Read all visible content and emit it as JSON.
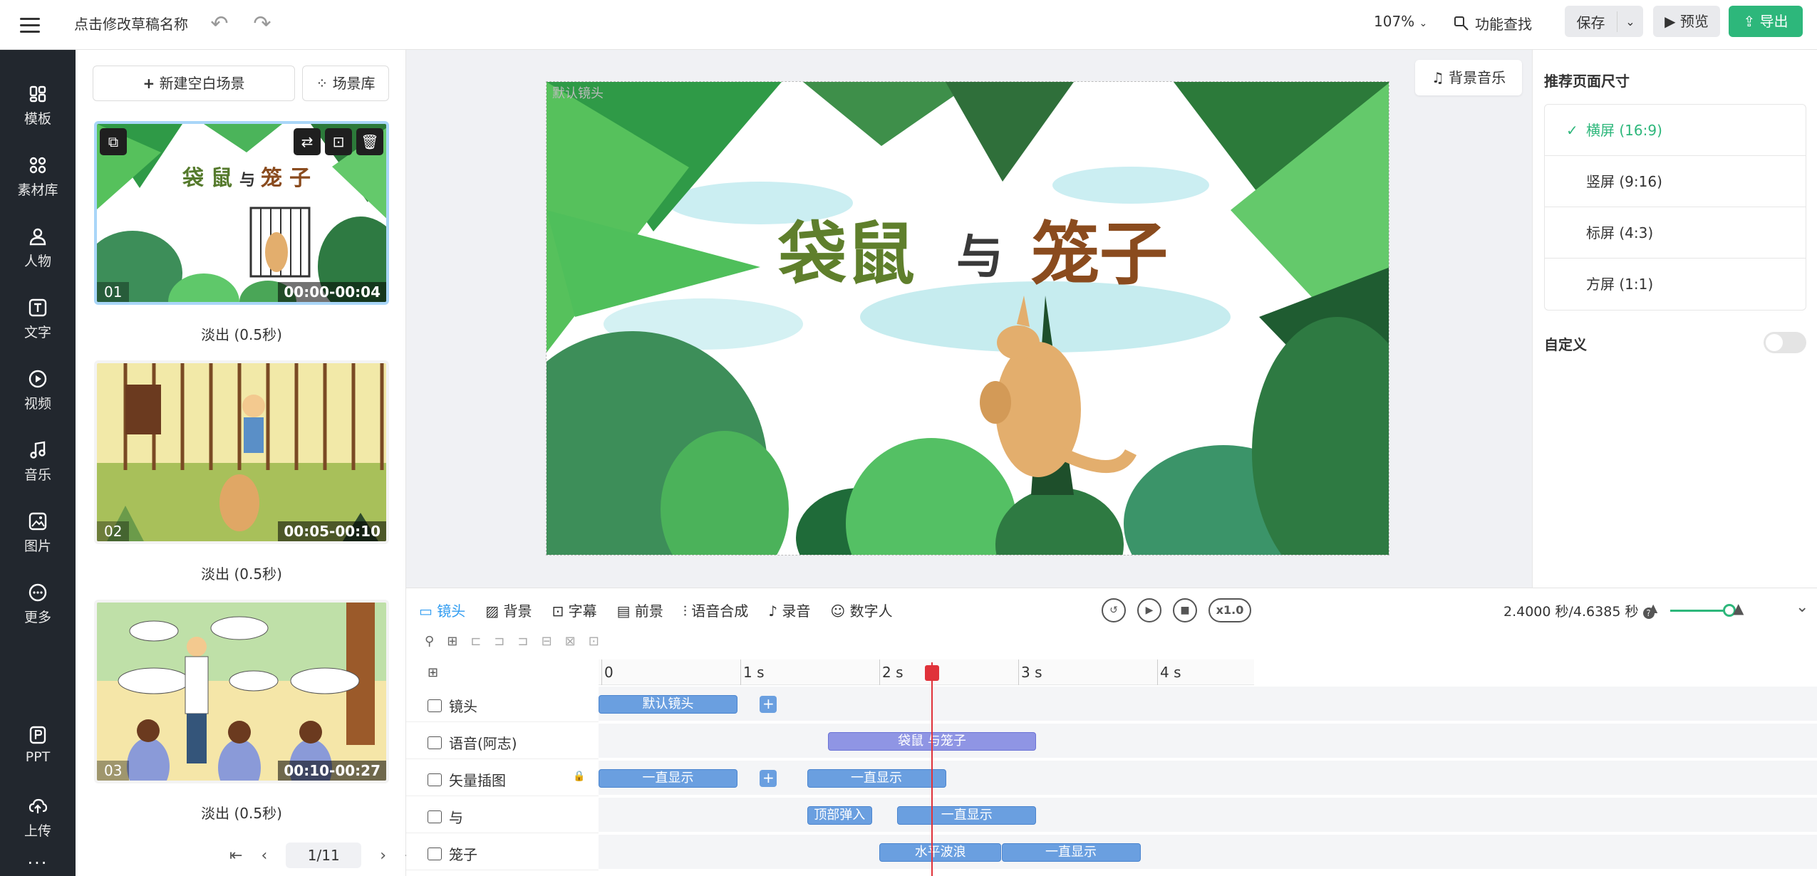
{
  "topbar": {
    "title": "点击修改草稿名称",
    "zoom": "107%",
    "find_label": "功能查找",
    "save_label": "保存",
    "preview_label": "预览",
    "export_label": "导出"
  },
  "nav": [
    {
      "label": "模板",
      "icon": "template-icon"
    },
    {
      "label": "素材库",
      "icon": "materials-icon"
    },
    {
      "label": "人物",
      "icon": "person-icon"
    },
    {
      "label": "文字",
      "icon": "text-icon"
    },
    {
      "label": "视频",
      "icon": "video-icon"
    },
    {
      "label": "音乐",
      "icon": "music-icon"
    },
    {
      "label": "图片",
      "icon": "image-icon"
    },
    {
      "label": "更多",
      "icon": "more-icon"
    },
    {
      "label": "PPT",
      "icon": "ppt-icon"
    },
    {
      "label": "上传",
      "icon": "upload-icon"
    }
  ],
  "scenes": {
    "new_label": "新建空白场景",
    "library_label": "场景库",
    "items": [
      {
        "num": "01",
        "time": "00:00-00:04",
        "transition": "淡出 (0.5秒)"
      },
      {
        "num": "02",
        "time": "00:05-00:10",
        "transition": "淡出 (0.5秒)"
      },
      {
        "num": "03",
        "time": "00:10-00:27",
        "transition": "淡出 (0.5秒)"
      }
    ],
    "page": "1/11"
  },
  "canvas": {
    "bgm_label": "背景音乐",
    "title_a": "袋鼠",
    "title_b": "与",
    "title_c": "笼子",
    "lens_label": "默认镜头"
  },
  "right_panel": {
    "title": "推荐页面尺寸",
    "options": [
      "横屏 (16:9)",
      "竖屏 (9:16)",
      "标屏 (4:3)",
      "方屏 (1:1)"
    ],
    "selected_index": 0,
    "custom_label": "自定义",
    "custom_on": false
  },
  "timeline": {
    "tabs": [
      "镜头",
      "背景",
      "字幕",
      "前景",
      "语音合成",
      "录音",
      "数字人"
    ],
    "speed": "x1.0",
    "time": "2.4000 秒/4.6385 秒",
    "zoom_level": 0.9,
    "playhead_seconds": 2.4,
    "ruler": [
      "0",
      "1 s",
      "2 s",
      "3 s",
      "4 s"
    ],
    "tracks": [
      {
        "label": "镜头",
        "clips": [
          {
            "text": "默认镜头",
            "start": 0,
            "end": 1.0,
            "type": "blue"
          }
        ]
      },
      {
        "label": "语音(阿志)",
        "clips": [
          {
            "text": "袋鼠 与笼子",
            "start": 1.65,
            "end": 3.15,
            "type": "purple"
          }
        ]
      },
      {
        "label": "矢量插图",
        "clips": [
          {
            "text": "一直显示",
            "start": 0,
            "end": 1.0,
            "type": "blue"
          },
          {
            "text": "一直显示",
            "start": 1.5,
            "end": 2.5,
            "type": "blue"
          }
        ]
      },
      {
        "label": "与",
        "clips": [
          {
            "text": "顶部弹入",
            "start": 1.5,
            "end": 1.97,
            "type": "blue"
          },
          {
            "text": "一直显示",
            "start": 2.15,
            "end": 3.15,
            "type": "blue"
          }
        ]
      },
      {
        "label": "笼子",
        "clips": [
          {
            "text": "水平波浪",
            "start": 2.02,
            "end": 2.9,
            "type": "blue"
          },
          {
            "text": "一直显示",
            "start": 2.9,
            "end": 3.9,
            "type": "blue"
          }
        ]
      }
    ]
  }
}
